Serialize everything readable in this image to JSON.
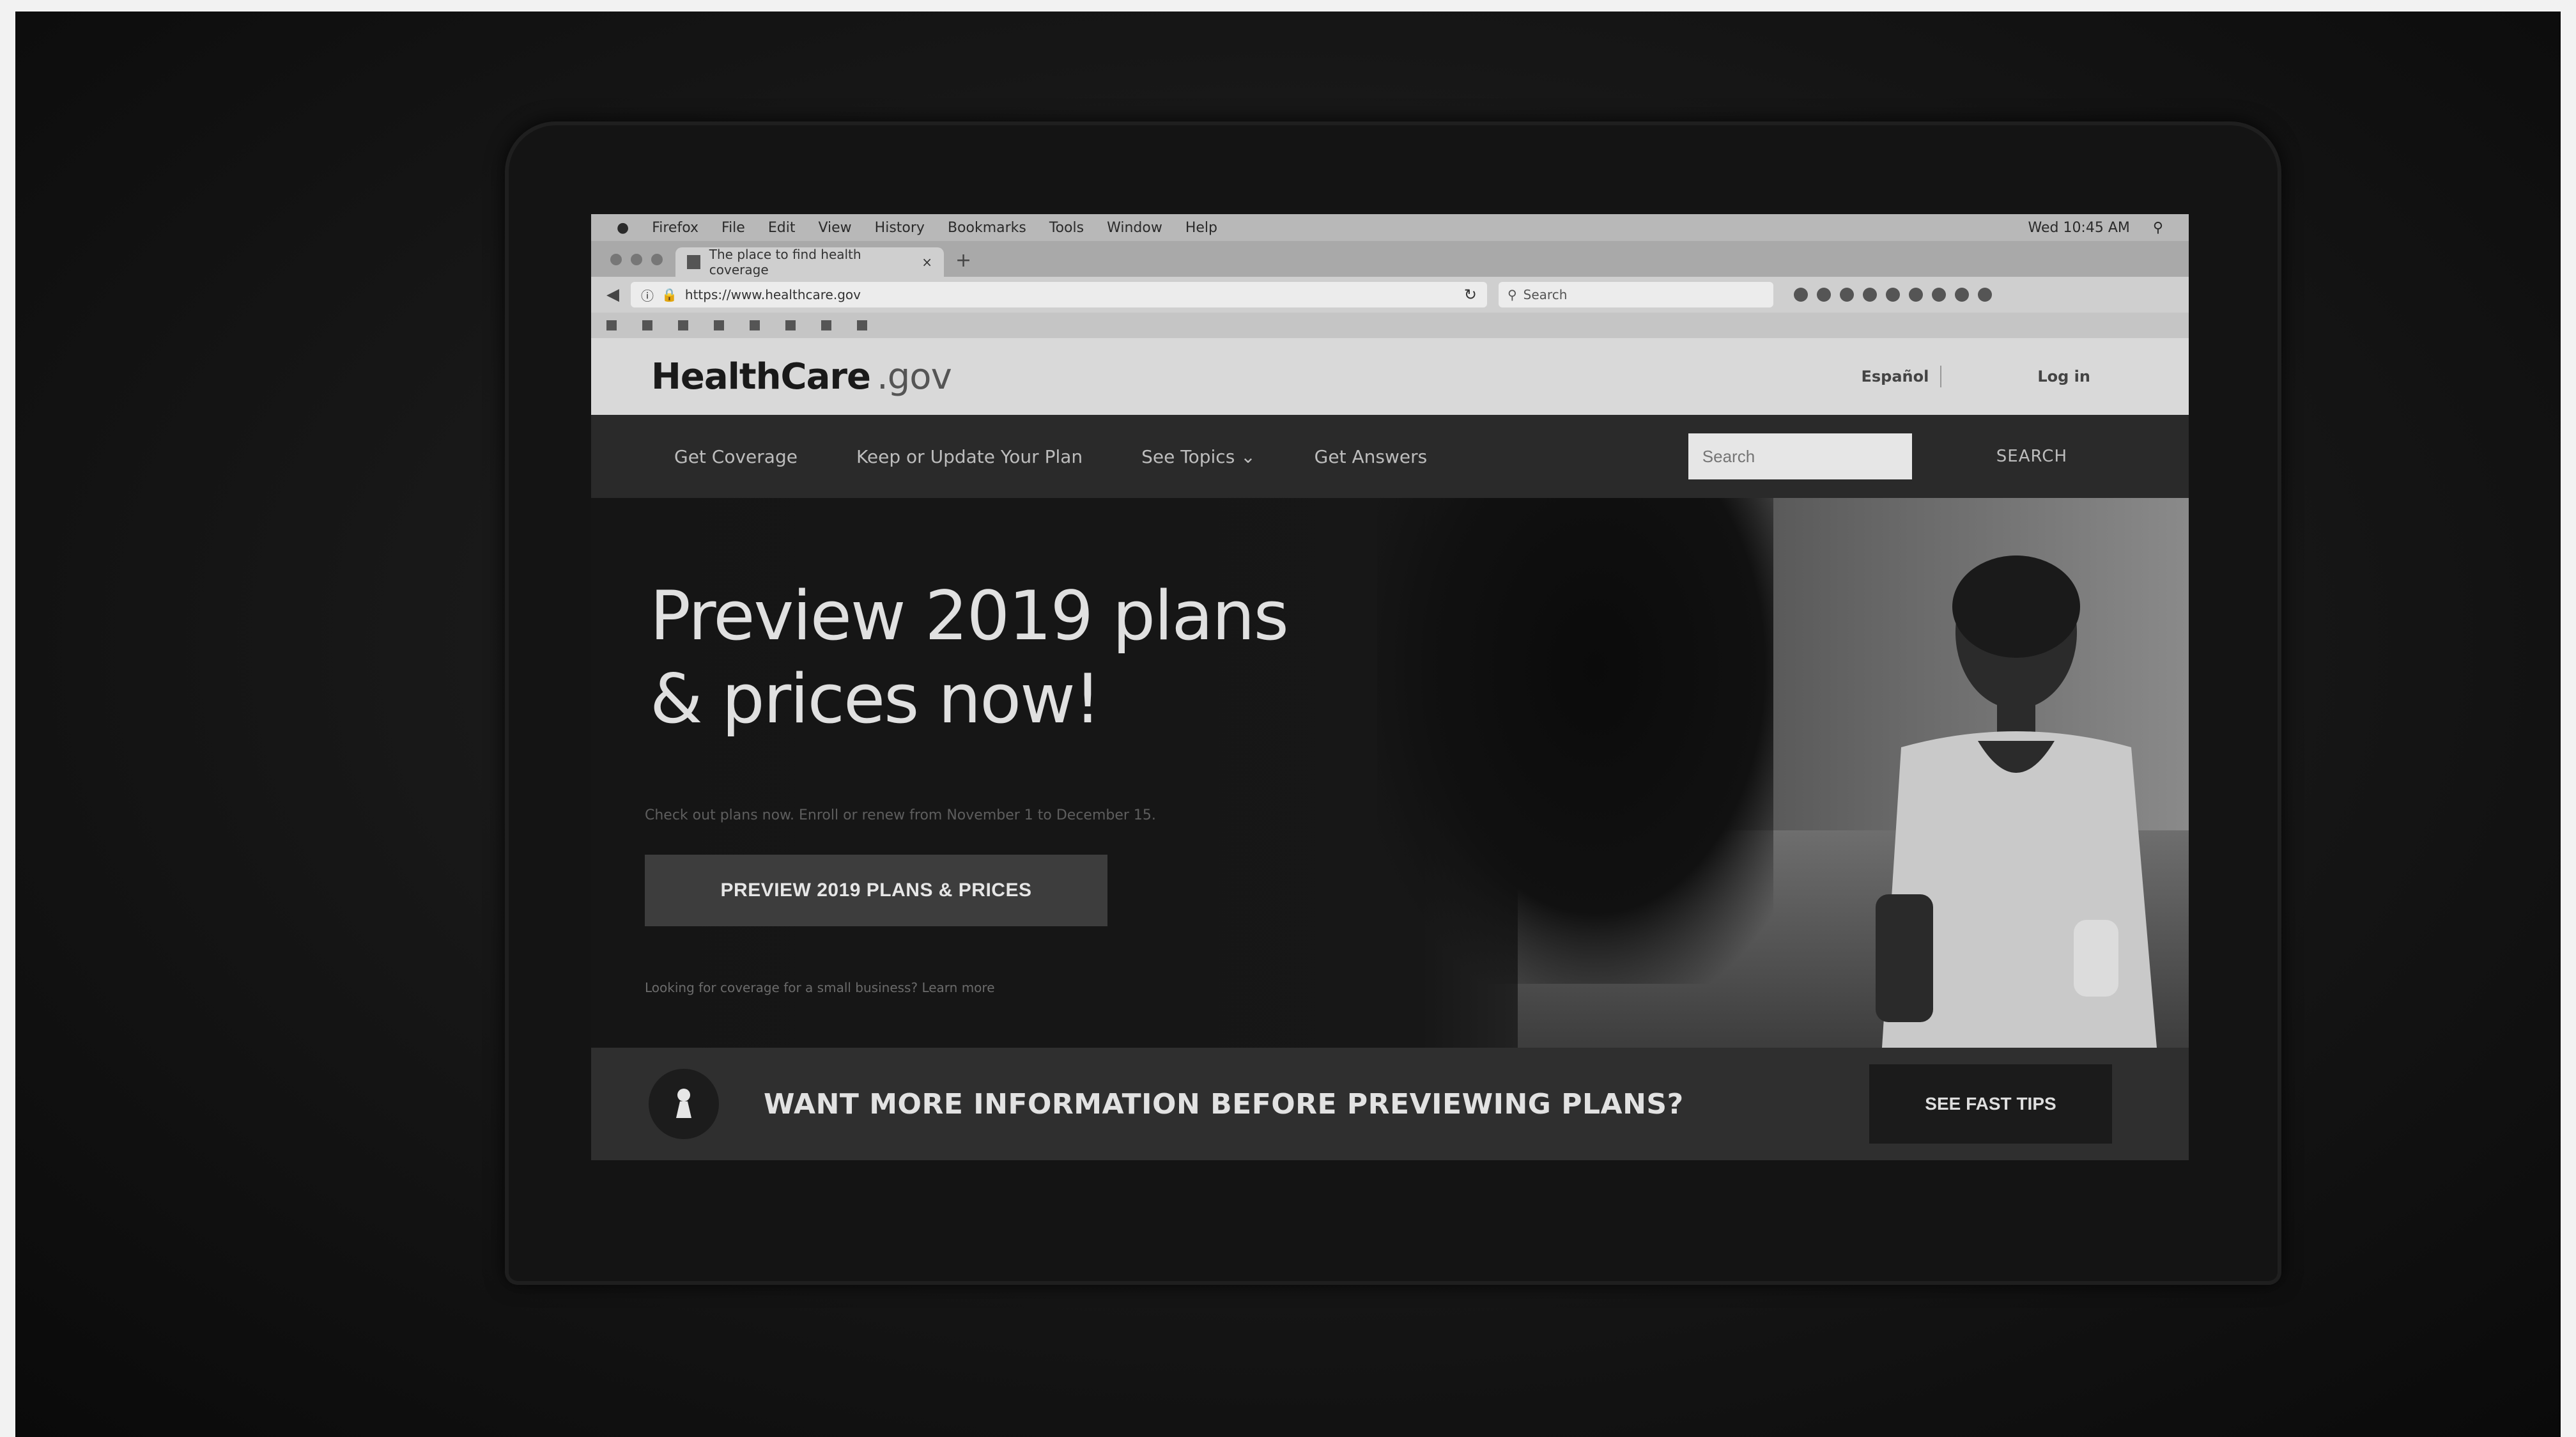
{
  "menubar": {
    "items": [
      "Firefox",
      "File",
      "Edit",
      "View",
      "History",
      "Bookmarks",
      "Tools",
      "Window",
      "Help"
    ],
    "clock": "Wed 10:45 AM"
  },
  "browser": {
    "tab_title": "The place to find health coverage",
    "url": "https://www.healthcare.gov",
    "search_placeholder": "Search"
  },
  "site": {
    "logo_main": "HealthCare",
    "logo_suffix": ".gov",
    "language_link": "Español",
    "login_link": "Log in",
    "nav": [
      "Get Coverage",
      "Keep or Update Your Plan",
      "See Topics",
      "Get Answers"
    ],
    "search_placeholder": "Search",
    "search_button": "SEARCH"
  },
  "hero": {
    "title_line1": "Preview 2019 plans",
    "title_line2": "& prices now!",
    "subtitle": "Check out plans now. Enroll or renew from November 1 to December 15.",
    "button": "PREVIEW 2019 PLANS & PRICES",
    "small_business": "Looking for coverage for a small business? Learn more"
  },
  "infobar": {
    "text": "WANT MORE INFORMATION BEFORE PREVIEWING PLANS?",
    "button": "SEE FAST TIPS"
  },
  "icons": {
    "back": "arrow-left-icon",
    "forward": "arrow-right-icon",
    "reload": "reload-icon",
    "info": "person-icon",
    "lock": "lock-icon"
  }
}
